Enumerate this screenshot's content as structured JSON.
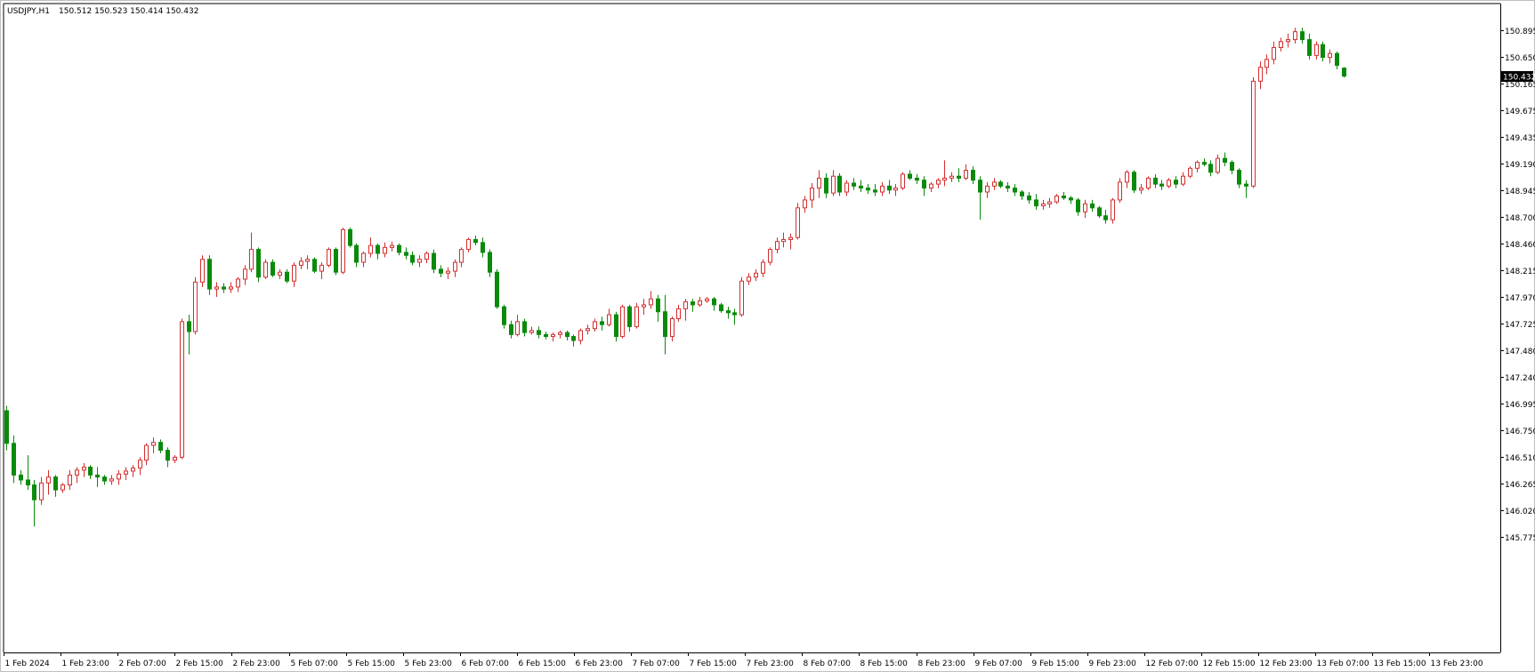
{
  "header": {
    "symbol": "USDJPY,H1",
    "ohlc": "150.512 150.523 150.414 150.432"
  },
  "colors": {
    "bull_body": "#ffffff",
    "bull_border": "#d32f2f",
    "bear_body": "#0a8a0a",
    "bear_border": "#0a8a0a",
    "price_tag_bg": "#000000",
    "price_tag_text": "#ffffff",
    "axis_line": "#000000",
    "frame": "#bfbfbf"
  },
  "chart_data": {
    "type": "candlestick",
    "symbol": "USDJPY",
    "timeframe": "H1",
    "ylim": [
      145.72,
      151.11
    ],
    "y_ticks": [
      "150.895",
      "150.650",
      "150.165",
      "149.675",
      "149.435",
      "149.190",
      "148.945",
      "148.700",
      "148.460",
      "148.215",
      "147.970",
      "147.725",
      "147.480",
      "147.240",
      "146.995",
      "146.750",
      "146.510",
      "146.265",
      "146.020",
      "145.775"
    ],
    "x_labels": [
      "1 Feb 2024",
      "1 Feb 23:00",
      "2 Feb 07:00",
      "2 Feb 15:00",
      "2 Feb 23:00",
      "5 Feb 07:00",
      "5 Feb 15:00",
      "5 Feb 23:00",
      "6 Feb 07:00",
      "6 Feb 15:00",
      "6 Feb 23:00",
      "7 Feb 07:00",
      "7 Feb 15:00",
      "7 Feb 23:00",
      "8 Feb 07:00",
      "8 Feb 15:00",
      "8 Feb 23:00",
      "9 Feb 07:00",
      "9 Feb 15:00",
      "9 Feb 23:00",
      "12 Feb 07:00",
      "12 Feb 15:00",
      "12 Feb 23:00",
      "13 Feb 07:00",
      "13 Feb 15:00",
      "13 Feb 23:00"
    ],
    "current_price": "150.432",
    "candles": [
      [
        147.05,
        147.1,
        146.65,
        146.72
      ],
      [
        146.72,
        146.8,
        146.32,
        146.4
      ],
      [
        146.4,
        146.45,
        146.3,
        146.35
      ],
      [
        146.35,
        146.6,
        146.25,
        146.3
      ],
      [
        146.3,
        146.35,
        145.88,
        146.15
      ],
      [
        146.15,
        146.38,
        146.1,
        146.32
      ],
      [
        146.32,
        146.45,
        146.2,
        146.38
      ],
      [
        146.38,
        146.4,
        146.18,
        146.25
      ],
      [
        146.25,
        146.32,
        146.22,
        146.3
      ],
      [
        146.3,
        146.45,
        146.25,
        146.4
      ],
      [
        146.4,
        146.48,
        146.32,
        146.45
      ],
      [
        146.45,
        146.52,
        146.38,
        146.48
      ],
      [
        146.48,
        146.5,
        146.36,
        146.4
      ],
      [
        146.4,
        146.48,
        146.28,
        146.38
      ],
      [
        146.38,
        146.4,
        146.3,
        146.34
      ],
      [
        146.34,
        146.4,
        146.3,
        146.36
      ],
      [
        146.36,
        146.45,
        146.3,
        146.41
      ],
      [
        146.41,
        146.48,
        146.35,
        146.44
      ],
      [
        146.44,
        146.5,
        146.38,
        146.47
      ],
      [
        146.47,
        146.58,
        146.4,
        146.55
      ],
      [
        146.55,
        146.72,
        146.5,
        146.7
      ],
      [
        146.7,
        146.78,
        146.62,
        146.73
      ],
      [
        146.73,
        146.76,
        146.62,
        146.65
      ],
      [
        146.65,
        146.68,
        146.48,
        146.55
      ],
      [
        146.55,
        146.6,
        146.52,
        146.58
      ],
      [
        146.58,
        147.98,
        146.56,
        147.95
      ],
      [
        147.95,
        148.02,
        147.62,
        147.85
      ],
      [
        147.85,
        148.4,
        147.82,
        148.35
      ],
      [
        148.35,
        148.62,
        148.3,
        148.58
      ],
      [
        148.58,
        148.62,
        148.22,
        148.28
      ],
      [
        148.28,
        148.35,
        148.2,
        148.3
      ],
      [
        148.3,
        148.34,
        148.24,
        148.28
      ],
      [
        148.28,
        148.35,
        148.24,
        148.3
      ],
      [
        148.3,
        148.4,
        148.25,
        148.38
      ],
      [
        148.38,
        148.52,
        148.32,
        148.48
      ],
      [
        148.48,
        148.85,
        148.45,
        148.68
      ],
      [
        148.68,
        148.7,
        148.35,
        148.4
      ],
      [
        148.4,
        148.58,
        148.38,
        148.55
      ],
      [
        148.55,
        148.58,
        148.4,
        148.42
      ],
      [
        148.42,
        148.48,
        148.38,
        148.45
      ],
      [
        148.45,
        148.48,
        148.34,
        148.36
      ],
      [
        148.36,
        148.55,
        148.3,
        148.52
      ],
      [
        148.52,
        148.6,
        148.48,
        148.56
      ],
      [
        148.56,
        148.62,
        148.48,
        148.58
      ],
      [
        148.58,
        148.6,
        148.44,
        148.46
      ],
      [
        148.46,
        148.55,
        148.38,
        148.52
      ],
      [
        148.52,
        148.7,
        148.5,
        148.68
      ],
      [
        148.68,
        148.7,
        148.42,
        148.45
      ],
      [
        148.45,
        148.9,
        148.43,
        148.88
      ],
      [
        148.88,
        148.9,
        148.7,
        148.72
      ],
      [
        148.72,
        148.74,
        148.5,
        148.55
      ],
      [
        148.55,
        148.66,
        148.5,
        148.64
      ],
      [
        148.64,
        148.8,
        148.6,
        148.72
      ],
      [
        148.72,
        148.74,
        148.58,
        148.64
      ],
      [
        148.64,
        148.75,
        148.6,
        148.7
      ],
      [
        148.7,
        148.76,
        148.66,
        148.72
      ],
      [
        148.72,
        148.74,
        148.62,
        148.65
      ],
      [
        148.65,
        148.7,
        148.58,
        148.62
      ],
      [
        148.62,
        148.66,
        148.52,
        148.55
      ],
      [
        148.55,
        148.62,
        148.5,
        148.58
      ],
      [
        148.58,
        148.66,
        148.54,
        148.64
      ],
      [
        148.64,
        148.68,
        148.44,
        148.48
      ],
      [
        148.48,
        148.52,
        148.4,
        148.44
      ],
      [
        148.44,
        148.5,
        148.38,
        148.46
      ],
      [
        148.46,
        148.58,
        148.4,
        148.55
      ],
      [
        148.55,
        148.7,
        148.5,
        148.68
      ],
      [
        148.68,
        148.8,
        148.65,
        148.78
      ],
      [
        148.78,
        148.82,
        148.72,
        148.75
      ],
      [
        148.75,
        148.8,
        148.6,
        148.65
      ],
      [
        148.65,
        148.68,
        148.4,
        148.45
      ],
      [
        148.45,
        148.48,
        148.08,
        148.1
      ],
      [
        148.1,
        148.12,
        147.88,
        147.92
      ],
      [
        147.92,
        147.96,
        147.78,
        147.82
      ],
      [
        147.82,
        148.02,
        147.8,
        147.95
      ],
      [
        147.95,
        147.98,
        147.8,
        147.84
      ],
      [
        147.84,
        147.9,
        147.82,
        147.86
      ],
      [
        147.86,
        147.9,
        147.78,
        147.82
      ],
      [
        147.82,
        147.85,
        147.77,
        147.8
      ],
      [
        147.8,
        147.84,
        147.75,
        147.82
      ],
      [
        147.82,
        147.86,
        147.78,
        147.84
      ],
      [
        147.84,
        147.86,
        147.76,
        147.8
      ],
      [
        147.8,
        147.82,
        147.7,
        147.76
      ],
      [
        147.76,
        147.88,
        147.72,
        147.86
      ],
      [
        147.86,
        147.92,
        147.82,
        147.88
      ],
      [
        147.88,
        147.98,
        147.85,
        147.95
      ],
      [
        147.95,
        148.0,
        147.86,
        147.92
      ],
      [
        147.92,
        148.08,
        147.9,
        148.02
      ],
      [
        148.02,
        148.05,
        147.75,
        147.8
      ],
      [
        147.8,
        148.12,
        147.78,
        148.1
      ],
      [
        148.1,
        148.12,
        147.85,
        147.9
      ],
      [
        147.9,
        148.14,
        147.88,
        148.1
      ],
      [
        148.1,
        148.18,
        148.02,
        148.12
      ],
      [
        148.12,
        148.26,
        148.08,
        148.18
      ],
      [
        148.18,
        148.22,
        147.95,
        148.05
      ],
      [
        148.05,
        148.22,
        147.62,
        147.8
      ],
      [
        147.8,
        148.0,
        147.75,
        147.98
      ],
      [
        147.98,
        148.12,
        147.95,
        148.08
      ],
      [
        148.08,
        148.18,
        147.96,
        148.15
      ],
      [
        148.15,
        148.18,
        148.05,
        148.12
      ],
      [
        148.12,
        148.2,
        148.1,
        148.16
      ],
      [
        148.16,
        148.2,
        148.14,
        148.18
      ],
      [
        148.18,
        148.2,
        148.06,
        148.12
      ],
      [
        148.12,
        148.14,
        148.04,
        148.06
      ],
      [
        148.06,
        148.1,
        147.98,
        148.04
      ],
      [
        148.04,
        148.08,
        147.92,
        148.02
      ],
      [
        148.02,
        148.4,
        148.0,
        148.36
      ],
      [
        148.36,
        148.44,
        148.32,
        148.4
      ],
      [
        148.4,
        148.48,
        148.36,
        148.44
      ],
      [
        148.44,
        148.58,
        148.4,
        148.55
      ],
      [
        148.55,
        148.7,
        148.52,
        148.68
      ],
      [
        148.68,
        148.8,
        148.64,
        148.76
      ],
      [
        148.76,
        148.85,
        148.7,
        148.78
      ],
      [
        148.78,
        148.84,
        148.68,
        148.8
      ],
      [
        148.8,
        149.15,
        148.78,
        149.1
      ],
      [
        149.1,
        149.22,
        149.05,
        149.18
      ],
      [
        149.18,
        149.35,
        149.1,
        149.3
      ],
      [
        149.3,
        149.48,
        149.2,
        149.4
      ],
      [
        149.4,
        149.45,
        149.2,
        149.25
      ],
      [
        149.25,
        149.48,
        149.22,
        149.42
      ],
      [
        149.42,
        149.45,
        149.22,
        149.26
      ],
      [
        149.26,
        149.38,
        149.22,
        149.35
      ],
      [
        149.35,
        149.4,
        149.28,
        149.32
      ],
      [
        149.32,
        149.38,
        149.26,
        149.3
      ],
      [
        149.3,
        149.34,
        149.24,
        149.28
      ],
      [
        149.28,
        149.34,
        149.22,
        149.26
      ],
      [
        149.26,
        149.36,
        149.22,
        149.32
      ],
      [
        149.32,
        149.38,
        149.24,
        149.28
      ],
      [
        149.28,
        149.34,
        149.22,
        149.3
      ],
      [
        149.3,
        149.46,
        149.28,
        149.44
      ],
      [
        149.44,
        149.48,
        149.38,
        149.4
      ],
      [
        149.4,
        149.44,
        149.34,
        149.38
      ],
      [
        149.38,
        149.42,
        149.22,
        149.3
      ],
      [
        149.3,
        149.36,
        149.26,
        149.34
      ],
      [
        149.34,
        149.4,
        149.3,
        149.38
      ],
      [
        149.38,
        149.58,
        149.32,
        149.4
      ],
      [
        149.4,
        149.46,
        149.36,
        149.42
      ],
      [
        149.42,
        149.5,
        149.36,
        149.4
      ],
      [
        149.4,
        149.54,
        149.38,
        149.48
      ],
      [
        149.48,
        149.52,
        149.34,
        149.38
      ],
      [
        149.38,
        149.42,
        148.98,
        149.26
      ],
      [
        149.26,
        149.36,
        149.2,
        149.32
      ],
      [
        149.32,
        149.4,
        149.28,
        149.36
      ],
      [
        149.36,
        149.38,
        149.3,
        149.32
      ],
      [
        149.32,
        149.36,
        149.26,
        149.3
      ],
      [
        149.3,
        149.34,
        149.22,
        149.26
      ],
      [
        149.26,
        149.28,
        149.18,
        149.22
      ],
      [
        149.22,
        149.26,
        149.14,
        149.18
      ],
      [
        149.18,
        149.24,
        149.08,
        149.12
      ],
      [
        149.12,
        149.18,
        149.08,
        149.14
      ],
      [
        149.14,
        149.2,
        149.1,
        149.16
      ],
      [
        149.16,
        149.24,
        149.14,
        149.22
      ],
      [
        149.22,
        149.26,
        149.18,
        149.2
      ],
      [
        149.2,
        149.22,
        149.14,
        149.18
      ],
      [
        149.18,
        149.2,
        149.02,
        149.06
      ],
      [
        149.06,
        149.18,
        149.0,
        149.14
      ],
      [
        149.14,
        149.18,
        149.06,
        149.1
      ],
      [
        149.1,
        149.12,
        149.0,
        149.02
      ],
      [
        149.02,
        149.08,
        148.94,
        148.98
      ],
      [
        148.98,
        149.2,
        148.94,
        149.18
      ],
      [
        149.18,
        149.4,
        149.15,
        149.36
      ],
      [
        149.36,
        149.48,
        149.3,
        149.46
      ],
      [
        149.46,
        149.48,
        149.25,
        149.28
      ],
      [
        149.28,
        149.34,
        149.24,
        149.3
      ],
      [
        149.3,
        149.42,
        149.28,
        149.4
      ],
      [
        149.4,
        149.44,
        149.3,
        149.34
      ],
      [
        149.34,
        149.38,
        149.28,
        149.32
      ],
      [
        149.32,
        149.4,
        149.3,
        149.38
      ],
      [
        149.38,
        149.42,
        149.3,
        149.34
      ],
      [
        149.34,
        149.46,
        149.32,
        149.42
      ],
      [
        149.42,
        149.52,
        149.4,
        149.5
      ],
      [
        149.5,
        149.58,
        149.46,
        149.56
      ],
      [
        149.56,
        149.6,
        149.52,
        149.54
      ],
      [
        149.54,
        149.58,
        149.42,
        149.46
      ],
      [
        149.46,
        149.64,
        149.44,
        149.6
      ],
      [
        149.6,
        149.66,
        149.52,
        149.56
      ],
      [
        149.56,
        149.58,
        149.44,
        149.48
      ],
      [
        149.48,
        149.5,
        149.3,
        149.34
      ],
      [
        149.34,
        149.38,
        149.2,
        149.32
      ],
      [
        149.32,
        150.42,
        149.3,
        150.38
      ],
      [
        150.38,
        150.58,
        150.3,
        150.52
      ],
      [
        150.52,
        150.65,
        150.45,
        150.6
      ],
      [
        150.6,
        150.78,
        150.55,
        150.72
      ],
      [
        150.72,
        150.82,
        150.68,
        150.78
      ],
      [
        150.78,
        150.86,
        150.72,
        150.8
      ],
      [
        150.8,
        150.92,
        150.76,
        150.88
      ],
      [
        150.88,
        150.92,
        150.76,
        150.8
      ],
      [
        150.8,
        150.86,
        150.6,
        150.64
      ],
      [
        150.64,
        150.78,
        150.6,
        150.75
      ],
      [
        150.75,
        150.78,
        150.58,
        150.62
      ],
      [
        150.62,
        150.7,
        150.56,
        150.66
      ],
      [
        150.66,
        150.68,
        150.5,
        150.54
      ],
      [
        150.512,
        150.523,
        150.414,
        150.432
      ]
    ]
  }
}
